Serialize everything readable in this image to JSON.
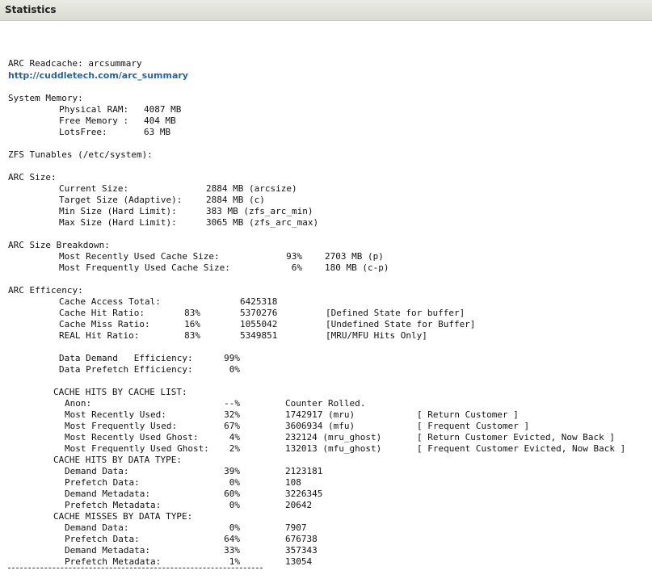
{
  "window": {
    "title": "Statistics"
  },
  "report": {
    "heading": "ARC Readcache: arcsummary",
    "link": "http://cuddletech.com/arc_summary",
    "system_memory": {
      "title": "System Memory:",
      "rows": [
        [
          "Physical RAM:",
          "4087 MB"
        ],
        [
          "Free Memory :",
          "404 MB"
        ],
        [
          "LotsFree:",
          "63 MB"
        ]
      ]
    },
    "zfs_tunables": "ZFS Tunables (/etc/system):",
    "arc_size": {
      "title": "ARC Size:",
      "rows": [
        [
          "Current Size:",
          "2884 MB (arcsize)"
        ],
        [
          "Target Size (Adaptive):",
          "2884 MB (c)"
        ],
        [
          "Min Size (Hard Limit):",
          "383 MB (zfs_arc_min)"
        ],
        [
          "Max Size (Hard Limit):",
          "3065 MB (zfs_arc_max)"
        ]
      ]
    },
    "arc_breakdown": {
      "title": "ARC Size Breakdown:",
      "rows": [
        [
          "Most Recently Used Cache Size:",
          "93%",
          "2703 MB (p)"
        ],
        [
          "Most Frequently Used Cache Size:",
          "6%",
          "180 MB (c-p)"
        ]
      ]
    },
    "arc_efficiency": {
      "title": "ARC Efficency:",
      "access_total_label": "Cache Access Total:",
      "access_total_value": "6425318",
      "rows": [
        [
          "Cache Hit Ratio:",
          "83%",
          "5370276",
          "[Defined State for buffer]"
        ],
        [
          "Cache Miss Ratio:",
          "16%",
          "1055042",
          "[Undefined State for Buffer]"
        ],
        [
          "REAL Hit Ratio:",
          "83%",
          "5349851",
          "[MRU/MFU Hits Only]"
        ]
      ],
      "demand_rows": [
        [
          "Data Demand   Efficiency:",
          "99%"
        ],
        [
          "Data Prefetch Efficiency:",
          "0%"
        ]
      ]
    },
    "hits_by_list": {
      "title": "CACHE HITS BY CACHE LIST:",
      "rows": [
        [
          "Anon:",
          "--%",
          "Counter Rolled.",
          ""
        ],
        [
          "Most Recently Used:",
          "32%",
          "1742917 (mru)",
          "[ Return Customer ]"
        ],
        [
          "Most Frequently Used:",
          "67%",
          "3606934 (mfu)",
          "[ Frequent Customer ]"
        ],
        [
          "Most Recently Used Ghost:",
          "4%",
          "232124 (mru_ghost)",
          "[ Return Customer Evicted, Now Back ]"
        ],
        [
          "Most Frequently Used Ghost:",
          "2%",
          "132013 (mfu_ghost)",
          "[ Frequent Customer Evicted, Now Back ]"
        ]
      ]
    },
    "hits_by_type": {
      "title": "CACHE HITS BY DATA TYPE:",
      "rows": [
        [
          "Demand Data:",
          "39%",
          "2123181"
        ],
        [
          "Prefetch Data:",
          "0%",
          "108"
        ],
        [
          "Demand Metadata:",
          "60%",
          "3226345"
        ],
        [
          "Prefetch Metadata:",
          "0%",
          "20642"
        ]
      ]
    },
    "misses_by_type": {
      "title": "CACHE MISSES BY DATA TYPE:",
      "rows": [
        [
          "Demand Data:",
          "0%",
          "7907"
        ],
        [
          "Prefetch Data:",
          "64%",
          "676738"
        ],
        [
          "Demand Metadata:",
          "33%",
          "357343"
        ],
        [
          "Prefetch Metadata:",
          "1%",
          "13054"
        ]
      ]
    },
    "separator": "---------------------------------------------"
  }
}
